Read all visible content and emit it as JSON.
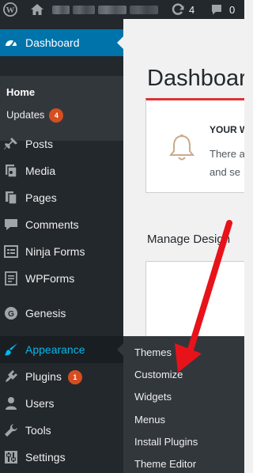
{
  "adminbar": {
    "wp_logo": "wordpress-logo",
    "home_icon": "home-icon",
    "updates_count": "4",
    "comments_count": "0"
  },
  "menu": {
    "dashboard": "Dashboard",
    "submenu": {
      "home": "Home",
      "updates": "Updates",
      "updates_count": "4"
    },
    "items": [
      "Posts",
      "Media",
      "Pages",
      "Comments",
      "Ninja Forms",
      "WPForms",
      "Genesis"
    ],
    "appearance": "Appearance",
    "plugins": "Plugins",
    "plugins_count": "1",
    "users": "Users",
    "tools": "Tools",
    "settings": "Settings"
  },
  "flyout": [
    "Themes",
    "Customize",
    "Widgets",
    "Menus",
    "Install Plugins",
    "Theme Editor"
  ],
  "content": {
    "title": "Dashboard",
    "notice_title": "YOUR W",
    "notice_line1": "There a",
    "notice_line2": "and se",
    "manage_title": "Manage Design"
  },
  "colors": {
    "accent": "#0073aa",
    "menu_bg": "#23282d",
    "submenu_bg": "#32373c",
    "highlight": "#00b9eb",
    "badge": "#d54e21",
    "annotation_arrow": "#e8121b"
  }
}
